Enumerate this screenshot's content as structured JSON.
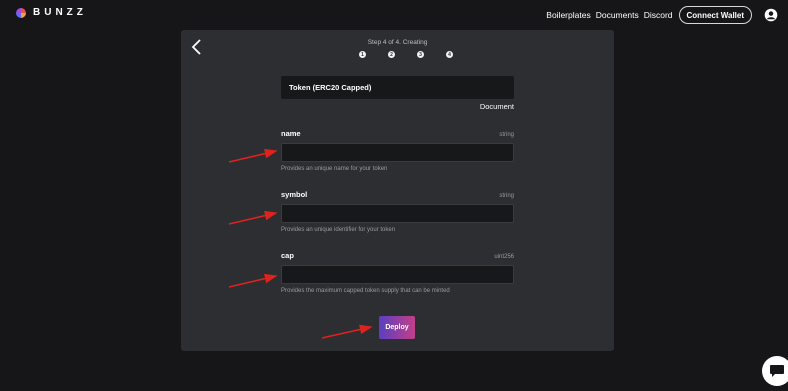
{
  "header": {
    "logo_text": "BUNZZ",
    "nav": [
      "Boilerplates",
      "Documents",
      "Discord"
    ],
    "connect_label": "Connect Wallet"
  },
  "wizard": {
    "step_label": "Step 4 of 4. Creating",
    "steps": [
      "1",
      "2",
      "3",
      "4"
    ],
    "token_type": "Token (ERC20 Capped)",
    "document_link": "Document"
  },
  "fields": [
    {
      "label": "name",
      "type": "string",
      "value": "",
      "help": "Provides an unique name for your token"
    },
    {
      "label": "symbol",
      "type": "string",
      "value": "",
      "help": "Provides an unique identifier for your token"
    },
    {
      "label": "cap",
      "type": "uint256",
      "value": "",
      "help": "Provides the maximum capped token supply that can be minted"
    }
  ],
  "deploy_label": "Deploy",
  "colors": {
    "background": "#161618",
    "panel": "#2d2e31",
    "input": "#17181a",
    "annotation_arrow": "#e0221f",
    "deploy_gradient_start": "#5b3fbf",
    "deploy_gradient_end": "#c23f8a"
  },
  "icons": [
    "bunzz-logo",
    "user-account-icon",
    "back-chevron-icon",
    "red-annotation-arrow",
    "chat-bubble-icon"
  ]
}
